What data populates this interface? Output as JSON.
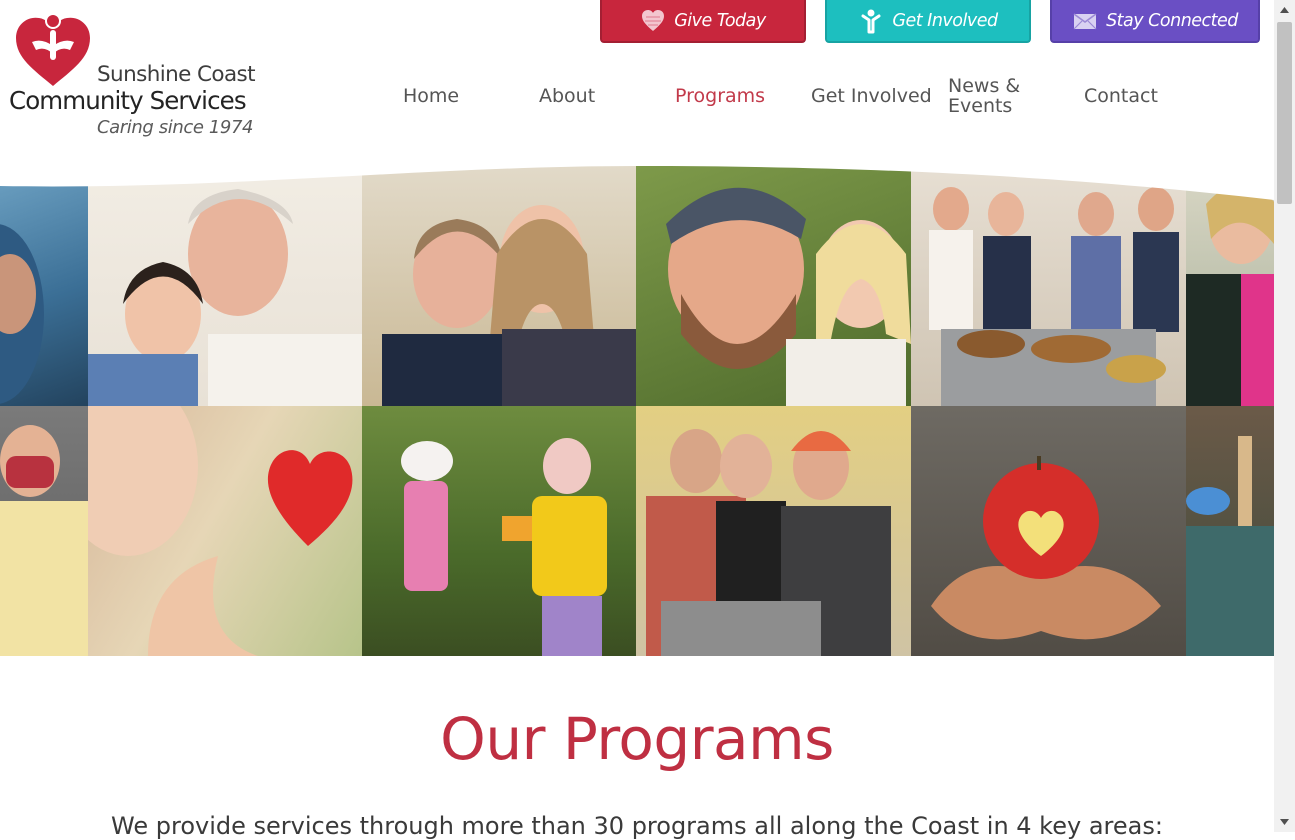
{
  "logo": {
    "line1": "Sunshine Coast",
    "line2": "Community Services",
    "line3": "Caring since 1974"
  },
  "actions": {
    "give": "Give Today",
    "involved": "Get Involved",
    "connect": "Stay Connected"
  },
  "nav": {
    "home": "Home",
    "about": "About",
    "programs": "Programs",
    "get_involved": "Get Involved",
    "news": "News & Events",
    "contact": "Contact",
    "active": "Programs"
  },
  "colors": {
    "brand_red": "#c8263d",
    "teal": "#1dbfbf",
    "purple": "#6a4fc4",
    "heading": "#bf2f42"
  },
  "icons": {
    "give": "heart-icon",
    "involved": "person-icon",
    "connect": "envelope-icon"
  },
  "main": {
    "heading": "Our Programs",
    "intro": "We provide services through more than 30 programs all along the Coast in 4 key areas:"
  }
}
